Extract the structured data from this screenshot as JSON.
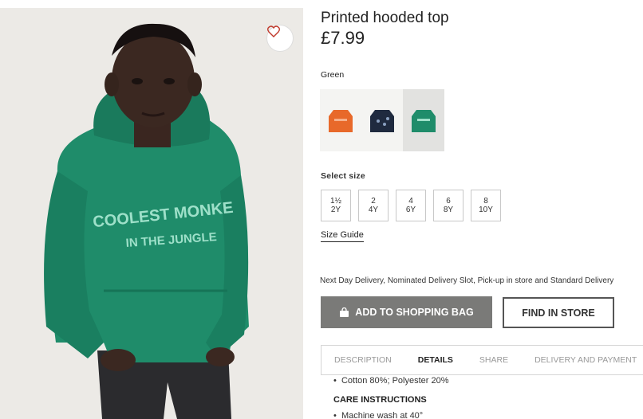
{
  "product": {
    "title": "Printed hooded top",
    "price": "£7.99",
    "color_name": "Green",
    "hoodie_print_line1": "COOLEST MONKE",
    "hoodie_print_line2": "IN THE JUNGLE"
  },
  "swatches": [
    {
      "name": "orange",
      "color": "#e8692a"
    },
    {
      "name": "navy",
      "color": "#1f2a3f"
    },
    {
      "name": "green",
      "color": "#1f8c6a",
      "selected": true
    }
  ],
  "sizes": {
    "label": "Select size",
    "options": [
      {
        "top": "1½",
        "bottom": "2Y"
      },
      {
        "top": "2",
        "bottom": "4Y"
      },
      {
        "top": "4",
        "bottom": "6Y"
      },
      {
        "top": "6",
        "bottom": "8Y"
      },
      {
        "top": "8",
        "bottom": "10Y"
      }
    ],
    "guide": "Size Guide"
  },
  "delivery_text": "Next Day Delivery, Nominated Delivery Slot, Pick-up in store and Standard Delivery",
  "actions": {
    "add_to_bag": "ADD TO SHOPPING BAG",
    "find_in_store": "FIND IN STORE"
  },
  "tabs": [
    {
      "label": "DESCRIPTION"
    },
    {
      "label": "DETAILS",
      "active": true
    },
    {
      "label": "SHARE"
    },
    {
      "label": "DELIVERY AND PAYMENT"
    }
  ],
  "details": {
    "composition": "Cotton 80%; Polyester 20%",
    "care_title": "CARE INSTRUCTIONS",
    "care_item": "Machine wash at 40°"
  },
  "icons": {
    "favorite": "heart-icon",
    "bag": "shopping-bag-icon"
  },
  "colors": {
    "heart": "#c0392b",
    "hoodie": "#1f8c6a",
    "button_bg": "#7a7a78"
  }
}
